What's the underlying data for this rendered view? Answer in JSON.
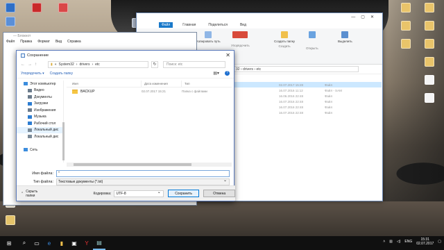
{
  "desktop": {
    "icons": [
      {
        "name": "desktop-icon-1",
        "label": ""
      },
      {
        "name": "desktop-icon-2",
        "label": ""
      },
      {
        "name": "desktop-icon-3",
        "label": ""
      },
      {
        "name": "desktop-icon-4",
        "label": ""
      },
      {
        "name": "desktop-icon-5",
        "label": ""
      },
      {
        "name": "desktop-icon-6",
        "label": ""
      },
      {
        "name": "desktop-icon-7",
        "label": ""
      },
      {
        "name": "desktop-icon-8",
        "label": ""
      }
    ]
  },
  "explorer": {
    "tabs": [
      "Файл",
      "Главная",
      "Поделиться",
      "Вид"
    ],
    "ribbon": {
      "copy_path": "Копировать путь",
      "organize": "Упорядочить",
      "new_folder": "Создать папку",
      "create": "Создать",
      "open": "Открыть",
      "select": "Выделить"
    },
    "address": "32 › drivers › etc",
    "rows": [
      {
        "date": "02.07.2017 15:28",
        "type": "Файл",
        "selected": true
      },
      {
        "date": "16.07.2016 11:12",
        "type": "Файл - SAM",
        "selected": false
      },
      {
        "date": "16.06.2016 22:48",
        "type": "Файл",
        "selected": false
      },
      {
        "date": "16.07.2016 22:48",
        "type": "Файл",
        "selected": false
      },
      {
        "date": "16.07.2016 22:48",
        "type": "Файл",
        "selected": false
      },
      {
        "date": "16.07.2016 22:48",
        "type": "Файл",
        "selected": false
      }
    ]
  },
  "notepad": {
    "title": "— Блокнот",
    "menu": [
      "Файл",
      "Правка",
      "Формат",
      "Вид",
      "Справка"
    ]
  },
  "dialog": {
    "title": "Сохранение",
    "breadcrumb": [
      "System32",
      "drivers",
      "etc"
    ],
    "search_placeholder": "Поиск: etc",
    "organize": "Упорядочить ▾",
    "new_folder": "Создать папку",
    "nav_items": [
      {
        "label": "Этот компьютер",
        "icon": "computer-icon",
        "color": "#3c8dde"
      },
      {
        "label": "Видео",
        "icon": "video-folder-icon",
        "color": "#6b7b8c"
      },
      {
        "label": "Документы",
        "icon": "documents-folder-icon",
        "color": "#6b7b8c"
      },
      {
        "label": "Загрузки",
        "icon": "downloads-folder-icon",
        "color": "#2d7dd2"
      },
      {
        "label": "Изображения",
        "icon": "pictures-folder-icon",
        "color": "#6b7b8c"
      },
      {
        "label": "Музыка",
        "icon": "music-folder-icon",
        "color": "#2d7dd2"
      },
      {
        "label": "Рабочий стол",
        "icon": "desktop-folder-icon",
        "color": "#2d7dd2"
      },
      {
        "label": "Локальный дис",
        "icon": "drive-icon",
        "color": "#7a8a99",
        "selected": true
      },
      {
        "label": "Локальный дис",
        "icon": "drive-icon",
        "color": "#7a8a99"
      },
      {
        "label": "",
        "icon": "",
        "color": ""
      },
      {
        "label": "Сеть",
        "icon": "network-icon",
        "color": "#3c8dde"
      }
    ],
    "columns": [
      "Имя",
      "Дата изменения",
      "Тип"
    ],
    "files": [
      {
        "name": "BACKUP",
        "date": "02.07.2017 15:21",
        "type": "Папка с файлами"
      }
    ],
    "filename_label": "Имя файла:",
    "filename_value": "\"",
    "filetype_label": "Тип файла:",
    "filetype_value": "Текстовые документы (*.txt)",
    "hide_folders": "Скрыть папки",
    "encoding_label": "Кодировка:",
    "encoding_value": "UTF-8",
    "save_button": "Сохранить",
    "cancel_button": "Отмена"
  },
  "taskbar": {
    "time": "15:31",
    "date": "02.07.2017",
    "lang": "ENG"
  }
}
